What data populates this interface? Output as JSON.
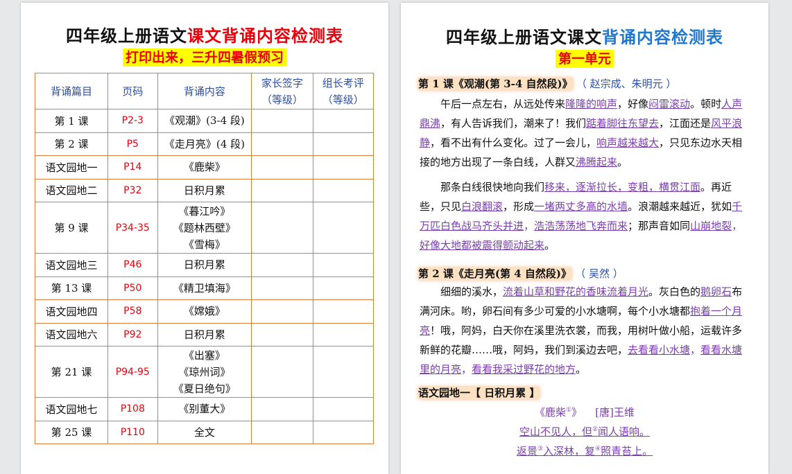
{
  "left": {
    "title_black": "四年级上册语文",
    "title_red": "课文背诵内容检测表",
    "subtitle": "打印出来，三升四暑假预习",
    "headers": [
      "背诵篇目",
      "页码",
      "背诵内容",
      "家长签字",
      "（等级）",
      "组长考评",
      "（等级）"
    ],
    "rows": [
      {
        "lesson": "第 1 课",
        "page": "P2-3",
        "content": [
          "《观潮》(3-4 段)"
        ]
      },
      {
        "lesson": "第 2 课",
        "page": "P5",
        "content": [
          "《走月亮》(4 段)"
        ]
      },
      {
        "lesson": "语文园地一",
        "page": "P14",
        "content": [
          "《鹿柴》"
        ]
      },
      {
        "lesson": "语文园地二",
        "page": "P32",
        "content": [
          "日积月累"
        ]
      },
      {
        "lesson": "第 9 课",
        "page": "P34-35",
        "content": [
          "《暮江吟》",
          "《题林西壁》",
          "《雪梅》"
        ]
      },
      {
        "lesson": "语文园地三",
        "page": "P46",
        "content": [
          "日积月累"
        ]
      },
      {
        "lesson": "第 13 课",
        "page": "P50",
        "content": [
          "《精卫填海》"
        ]
      },
      {
        "lesson": "语文园地四",
        "page": "P58",
        "content": [
          "《嫦娥》"
        ]
      },
      {
        "lesson": "语文园地六",
        "page": "P92",
        "content": [
          "日积月累"
        ]
      },
      {
        "lesson": "第 21 课",
        "page": "P94-95",
        "content": [
          "《出塞》",
          "《琼州词》",
          "《夏日绝句》"
        ]
      },
      {
        "lesson": "语文园地七",
        "page": "P108",
        "content": [
          "《别董大》"
        ]
      },
      {
        "lesson": "第 25 课",
        "page": "P110",
        "content": [
          "全文"
        ]
      }
    ]
  },
  "right": {
    "title_black": "四年级上册语文课文",
    "title_blue": "背诵内容检测表",
    "unit": "第一单元",
    "s1_head": "第 1 课《观潮(第 3-4 自然段)》",
    "s1_author": "（ 赵宗成、朱明元 ）",
    "p1": [
      {
        "t": "午后一点左右，从远处传来"
      },
      {
        "t": "隆隆的响声",
        "u": true
      },
      {
        "t": "，好像"
      },
      {
        "t": "闷雷滚动",
        "u": true
      },
      {
        "t": "。顿时"
      },
      {
        "t": "人声鼎沸",
        "u": true
      },
      {
        "t": "，有人告诉我们，潮来了！我们"
      },
      {
        "t": "踮着脚往东望去",
        "u": true
      },
      {
        "t": "，江面还是"
      },
      {
        "t": "风平浪静",
        "u": true
      },
      {
        "t": "，看不出有什么变化。过了一会儿，"
      },
      {
        "t": "响声越来越大",
        "u": true
      },
      {
        "t": "，只见东边水天相接的地方出现了一条白线，人群又"
      },
      {
        "t": "沸腾起来",
        "u": true
      },
      {
        "t": "。"
      }
    ],
    "p2": [
      {
        "t": "那条白线很快地向我们"
      },
      {
        "t": "移来，逐渐拉长，变粗，横贯江面",
        "u": true
      },
      {
        "t": "。再近些，只见"
      },
      {
        "t": "白浪翻滚",
        "u": true
      },
      {
        "t": "，形成"
      },
      {
        "t": "一堵两丈多高的水墙",
        "u": true
      },
      {
        "t": "。浪潮越来越近，犹如"
      },
      {
        "t": "千万匹白色战马齐头并进",
        "u": true
      },
      {
        "t": "，",
        "m": true
      },
      {
        "t": "浩浩荡荡地飞奔而来",
        "u": true
      },
      {
        "t": "；那声音如同"
      },
      {
        "t": "山崩地裂",
        "u": true
      },
      {
        "t": "，",
        "m": true
      },
      {
        "t": "好像大地都被震得颤动起来",
        "u": true
      },
      {
        "t": "。"
      }
    ],
    "s2_head": "第 2 课《走月亮(第 4 自然段)》",
    "s2_author": "（ 吴然 ）",
    "p3": [
      {
        "t": "细细的溪水，"
      },
      {
        "t": "流着山草和野花的香味流着月光",
        "u": true
      },
      {
        "t": "。灰白色的"
      },
      {
        "t": "鹅卵石",
        "u": true
      },
      {
        "t": "布满河床。哟，卵石间有多少可爱的小水塘啊，每个小水塘都"
      },
      {
        "t": "抱着一个月亮",
        "u": true
      },
      {
        "t": "！哦，阿妈，白天你在溪里洗衣裳，而我，用树叶做小船，运载许多新鲜的花瓣……哦，阿妈，我们到溪边去吧，"
      },
      {
        "t": "去看看小水塘",
        "u": true
      },
      {
        "t": "，",
        "m": true
      },
      {
        "t": "看看水塘里的月亮",
        "u": true
      },
      {
        "t": "，",
        "m": true
      },
      {
        "t": "看看我采过野花的地方",
        "u": true
      },
      {
        "t": "。"
      }
    ],
    "s3_head": "语文园地一【 日积月累 】",
    "poem_title": "《鹿柴",
    "poem_title_sup": "①",
    "poem_title_end": "》",
    "poem_author": "[唐]王维",
    "poem_l1a": "空山不见人，但",
    "poem_l1sup": "②",
    "poem_l1b": "闻人语响。",
    "poem_l2a": "返景",
    "poem_l2sup": "③",
    "poem_l2b": "入深林，复",
    "poem_l2sup2": "④",
    "poem_l2c": "照青苔上。"
  }
}
